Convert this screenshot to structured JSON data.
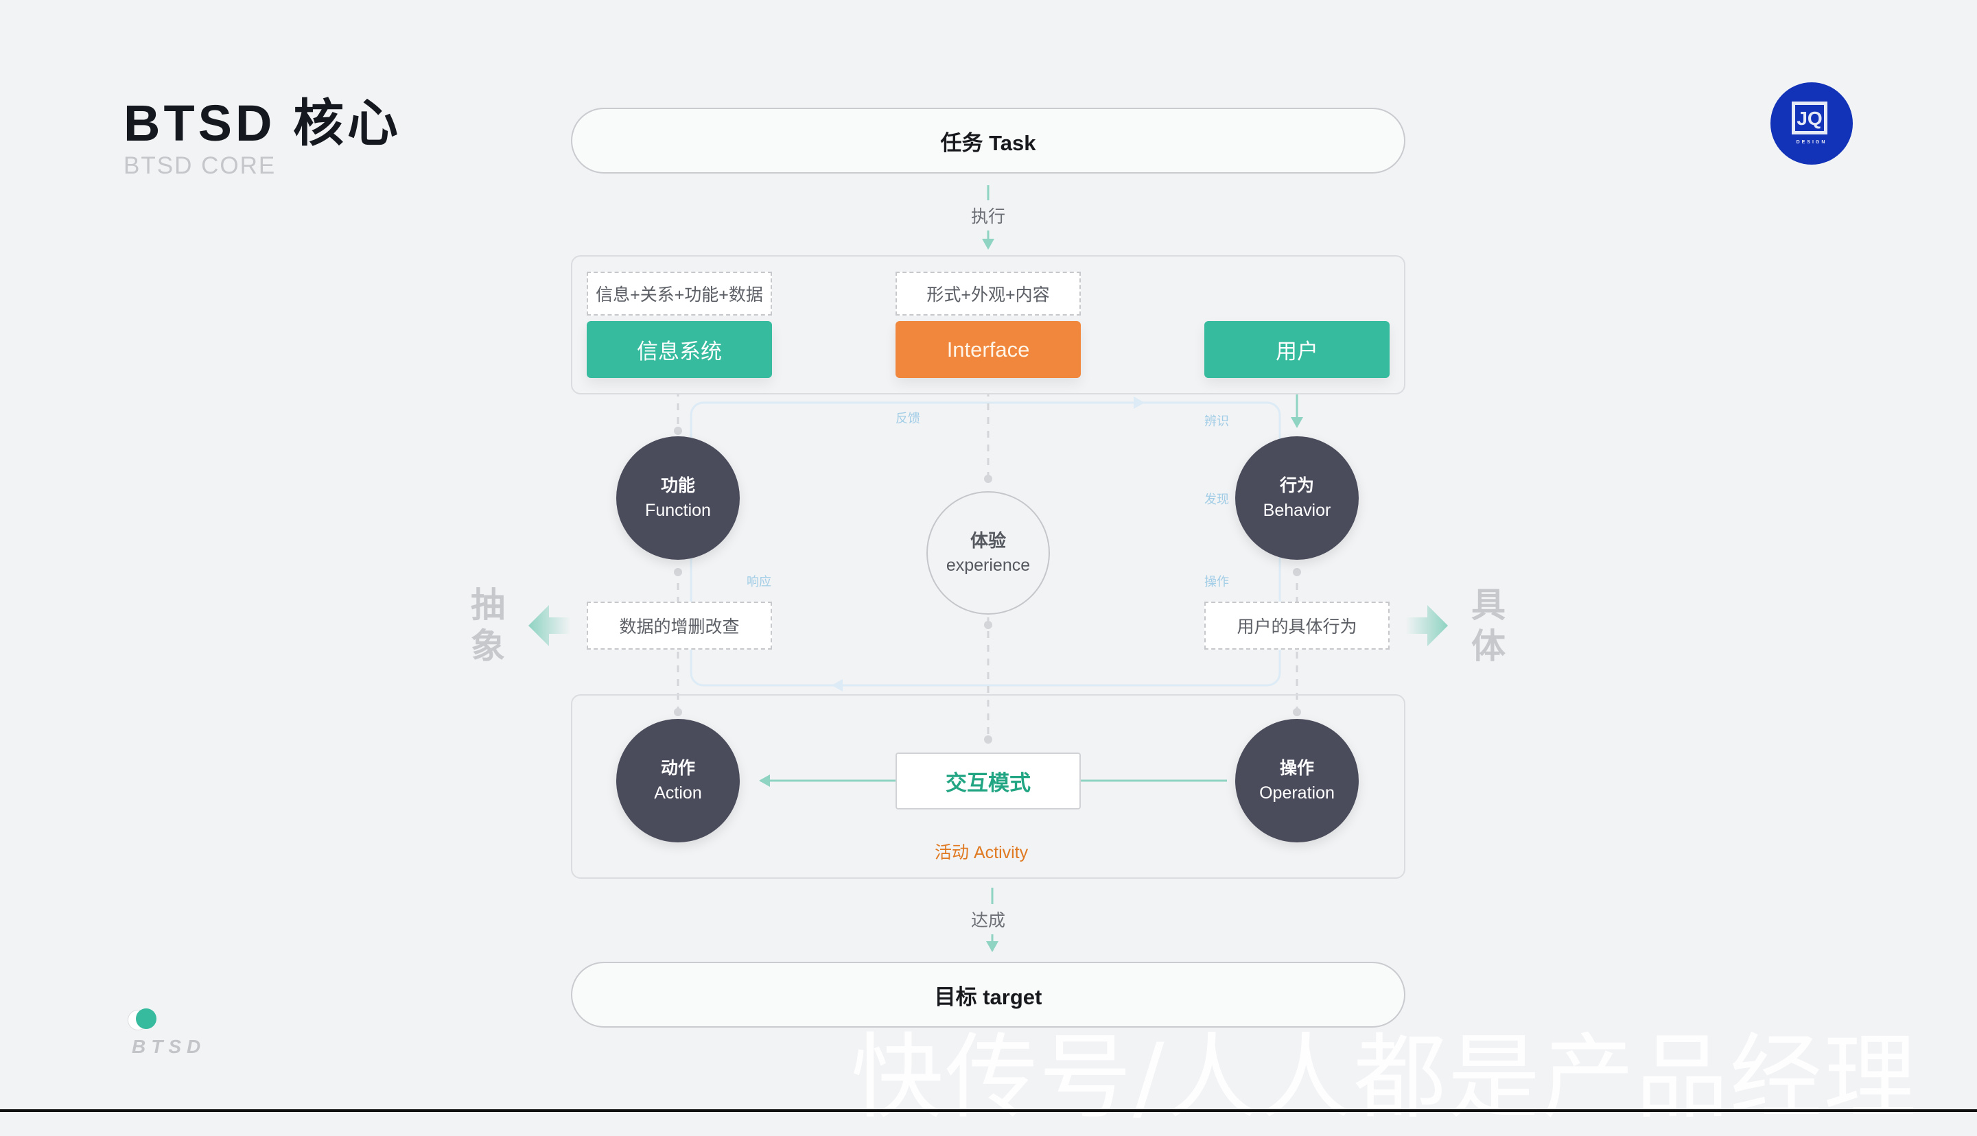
{
  "header": {
    "title": "BTSD 核心",
    "subtitle": "BTSD CORE"
  },
  "logo": {
    "glyph": "JQ",
    "text": "DESIGN",
    "color": "#1233b8"
  },
  "diagram": {
    "task": "任务 Task",
    "execute_label": "执行",
    "top_group": {
      "notes": [
        "信息+关系+功能+数据",
        "形式+外观+内容"
      ],
      "blocks": [
        {
          "label": "信息系统",
          "color": "#36bb9e"
        },
        {
          "label": "Interface",
          "color": "#f0873c"
        },
        {
          "label": "用户",
          "color": "#36bb9e"
        }
      ]
    },
    "loop_labels": {
      "feedback": "反馈",
      "identify": "辨识",
      "discover": "发现",
      "operate": "操作",
      "respond": "响应"
    },
    "nodes": {
      "function": {
        "zh": "功能",
        "en": "Function"
      },
      "behavior": {
        "zh": "行为",
        "en": "Behavior"
      },
      "experience": {
        "zh": "体验",
        "en": "experience"
      },
      "action": {
        "zh": "动作",
        "en": "Action"
      },
      "operation": {
        "zh": "操作",
        "en": "Operation"
      }
    },
    "mid_notes": {
      "left": "数据的增删改查",
      "right": "用户的具体行为"
    },
    "side_labels": {
      "abstract": [
        "抽",
        "象"
      ],
      "concrete": [
        "具",
        "体"
      ]
    },
    "interaction_mode": "交互模式",
    "activity": "活动 Activity",
    "achieve_label": "达成",
    "target": "目标 target"
  },
  "footer": {
    "brand": "BTSD",
    "watermark": "快传号/人人都是产品经理"
  },
  "colors": {
    "accent_green": "#36bb9e",
    "accent_orange": "#f0873c",
    "node_dark": "#4a4b5b",
    "arrow_green": "#8fd3c2",
    "loop_blue": "#dcebf5"
  }
}
